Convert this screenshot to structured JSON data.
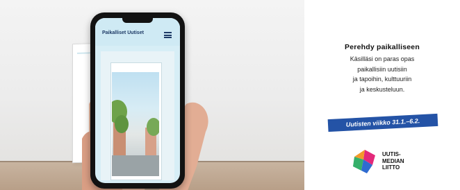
{
  "ad": {
    "headline": "Perehdy paikalliseen",
    "body_lines": [
      "Käsilläsi on paras opas",
      "paikallisiin uutisiin",
      "ja tapoihin, kulttuuriin",
      "ja keskusteluun."
    ],
    "week_badge": "Uutisten viikko 31.1.–6.2.",
    "logo_lines": [
      "UUTIS-",
      "MEDIAN",
      "LIITTO"
    ],
    "phone_app_logo": "Paikalliset Uutiset"
  },
  "colors": {
    "badge_bg": "#2453a6",
    "logo_pink": "#e3297a",
    "logo_blue": "#2f6bd0",
    "logo_green": "#35b06a",
    "logo_orange": "#f39a2b"
  }
}
